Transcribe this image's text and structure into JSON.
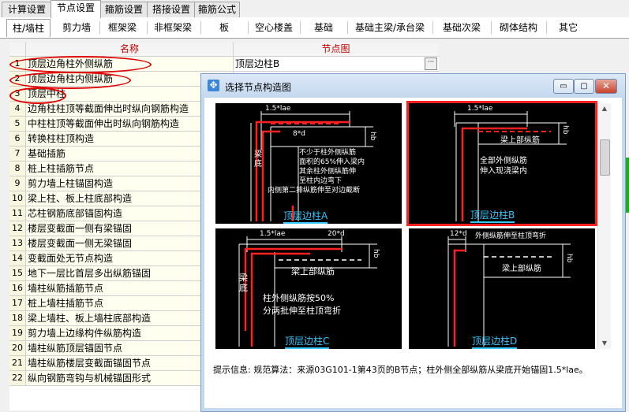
{
  "top_tabs": [
    "计算设置",
    "节点设置",
    "箍筋设置",
    "搭接设置",
    "箍筋公式"
  ],
  "top_tab_active": 1,
  "sub_tabs": [
    "柱/墙柱",
    "剪力墙",
    "框架梁",
    "非框架梁",
    "板",
    "空心楼盖",
    "基础",
    "基础主梁/承台梁",
    "基础次梁",
    "砌体结构",
    "其它"
  ],
  "grid": {
    "col_name": "名称",
    "col_diagram": "节点图",
    "rows": [
      {
        "n": "1",
        "name": "顶层边角柱外侧纵筋",
        "value": "顶层边柱B"
      },
      {
        "n": "2",
        "name": "顶层边角柱内侧纵筋",
        "value": ""
      },
      {
        "n": "3",
        "name": "顶层中柱",
        "value": ""
      },
      {
        "n": "4",
        "name": "边角柱柱顶等截面伸出时纵向钢筋构造",
        "value": ""
      },
      {
        "n": "5",
        "name": "中柱柱顶等截面伸出时纵向钢筋构造",
        "value": ""
      },
      {
        "n": "6",
        "name": "转换柱柱顶构造",
        "value": ""
      },
      {
        "n": "7",
        "name": "基础插筋",
        "value": ""
      },
      {
        "n": "8",
        "name": "桩上柱插筋节点",
        "value": ""
      },
      {
        "n": "9",
        "name": "剪力墙上柱锚固构造",
        "value": ""
      },
      {
        "n": "10",
        "name": "梁上柱、板上柱底部构造",
        "value": ""
      },
      {
        "n": "11",
        "name": "芯柱钢筋底部锚固构造",
        "value": ""
      },
      {
        "n": "12",
        "name": "楼层变截面一侧有梁锚固",
        "value": ""
      },
      {
        "n": "13",
        "name": "楼层变截面一侧无梁锚固",
        "value": ""
      },
      {
        "n": "14",
        "name": "变截面处无节点构造",
        "value": ""
      },
      {
        "n": "15",
        "name": "地下一层比首层多出纵筋锚固",
        "value": ""
      },
      {
        "n": "16",
        "name": "墙柱纵筋插筋节点",
        "value": ""
      },
      {
        "n": "17",
        "name": "桩上墙柱插筋节点",
        "value": ""
      },
      {
        "n": "18",
        "name": "梁上墙柱、板上墙柱底部构造",
        "value": ""
      },
      {
        "n": "19",
        "name": "剪力墙上边缘构件纵筋构造",
        "value": ""
      },
      {
        "n": "20",
        "name": "墙柱纵筋顶层锚固节点",
        "value": ""
      },
      {
        "n": "21",
        "name": "墙柱纵筋楼层变截面锚固节点",
        "value": ""
      },
      {
        "n": "22",
        "name": "纵向钢筋弯钩与机械锚固形式",
        "value": ""
      }
    ],
    "ellipsis": "···"
  },
  "dialog": {
    "title": "选择节点构造图",
    "buttons": {
      "minimize": "▭",
      "maximize": "▢",
      "close": "✕"
    },
    "panels": [
      {
        "caption": "顶层边柱A",
        "dims": [
          "1.5*lae",
          "8*d",
          "hb"
        ],
        "side_label": "梁底",
        "texts": [
          "不少于柱外侧纵筋",
          "面积的65%伸入梁内",
          "其余柱外侧纵筋伸",
          "至柱内边弯下",
          "内侧第二排纵筋伸至对边截断"
        ],
        "selected": false
      },
      {
        "caption": "顶层边柱B",
        "dims": [
          "1.5*lae",
          "hb"
        ],
        "side_label": "",
        "texts": [
          "梁上部纵筋",
          "全部外侧纵筋",
          "伸入现浇梁内"
        ],
        "selected": true
      },
      {
        "caption": "顶层边柱C",
        "dims": [
          "1.5*lae",
          "20*d",
          "hb"
        ],
        "side_label": "梁底",
        "texts": [
          "梁上部纵筋",
          "柱外侧纵筋按50%",
          "分两批伸至柱顶弯折"
        ],
        "selected": false
      },
      {
        "caption": "顶层边柱D",
        "dims": [
          "12*d",
          "外侧纵筋伸至柱顶弯折",
          "hb"
        ],
        "side_label": "",
        "texts": [
          "梁上部纵筋"
        ],
        "selected": false
      }
    ],
    "hint_label": "提示信息:",
    "hint_text": "规范算法：来源03G101-1第43页的B节点；柱外侧全部纵筋从梁底开始锚固1.5*lae。"
  },
  "colors": {
    "accent_red": "#e00000",
    "caption_cyan": "#33c8ff",
    "rebar_red": "#ff2020"
  }
}
